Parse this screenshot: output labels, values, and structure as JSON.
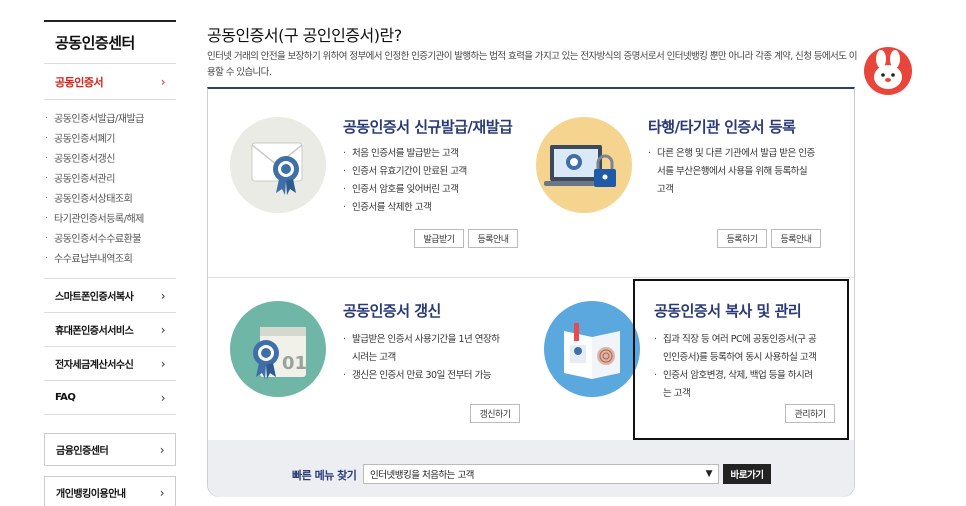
{
  "sidebar": {
    "title": "공동인증센터",
    "active": "공동인증서",
    "sub_items": [
      "공동인증서발급/재발급",
      "공동인증서폐기",
      "공동인증서갱신",
      "공동인증서관리",
      "공동인증서상태조회",
      "타기관인증서등록/해제",
      "공동인증서수수료환불",
      "수수료납부내역조회"
    ],
    "rows": [
      "스마트폰인증서복사",
      "휴대폰인증서서비스",
      "전자세금계산서수신",
      "FAQ"
    ],
    "boxes": [
      "금융인증센터",
      "개인뱅킹이용안내"
    ],
    "chevron": "›"
  },
  "main": {
    "title": "공동인증서(구 공인인증서)란?",
    "desc": "인터넷 거래의 안전을 보장하기 위하여 정부에서 인정한 인증기관이 발행하는 법적 효력을 가지고 있는 전자방식의 증명서로서 인터넷뱅킹 뿐만 아니라 각종 계약, 신청 등에서도 이용할 수 있습니다."
  },
  "cards": {
    "issue": {
      "title": "공동인증서 신규발급/재발급",
      "bullets": [
        "처음 인증서를 발급받는 고객",
        "인증서 유효기간이 만료된 고객",
        "인증서 암호를 잊어버린 고객",
        "인증서를 삭제한 고객"
      ],
      "buttons": [
        "발급받기",
        "등록안내"
      ]
    },
    "register": {
      "title": "타행/타기관 인증서 등록",
      "bullets": [
        "다른 은행 및 다른 기관에서 발급 받은 인증서를 부산은행에서 사용을 위해 등록하실 고객"
      ],
      "buttons": [
        "등록하기",
        "등록안내"
      ]
    },
    "renew": {
      "title": "공동인증서 갱신",
      "bullets": [
        "발급받은 인증서 사용기간을 1년 연장하시려는 고객",
        "갱신은 인증서 만료 30일 전부터 가능"
      ],
      "buttons": [
        "갱신하기"
      ]
    },
    "manage": {
      "title": "공동인증서 복사 및 관리",
      "bullets": [
        "집과 직장 등 여러 PC에 공동인증서(구 공인인증서)를 등록하여 동시 사용하실 고객",
        "인증서 암호변경, 삭제, 백업 등을 하시려는 고객"
      ],
      "buttons": [
        "관리하기"
      ]
    }
  },
  "quick_menu": {
    "label": "빠른 메뉴 찾기",
    "selected": "인터넷뱅킹을 처음하는 고객",
    "go": "바로가기"
  },
  "colors": {
    "accent_red": "#d7261d",
    "title_navy": "#2a3a78",
    "panel_top": "#2a3f6e"
  }
}
